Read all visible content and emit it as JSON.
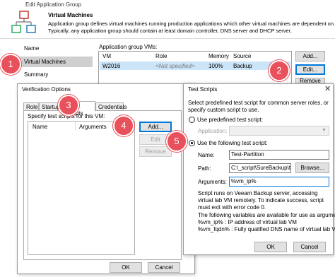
{
  "app_window": {
    "title": "Edit Application Group",
    "header_title": "Virtual Machines",
    "header_desc_1": "Application group defines virtual machines running production applications which other virtual machines are dependent on.",
    "header_desc_2": "Typically, any application group should contain at least domain controller, DNS server and DHCP server.",
    "nav": [
      "Name",
      "Virtual Machines",
      "Summary"
    ],
    "vms_label": "Application group VMs:",
    "columns": [
      "VM",
      "Role",
      "Memory",
      "Source"
    ],
    "rows": [
      {
        "vm": "W2016",
        "role": "<Not specified>",
        "memory": "100%",
        "source": "Backup"
      }
    ],
    "buttons": {
      "add": "Add...",
      "edit": "Edit...",
      "remove": "Remove"
    }
  },
  "verification": {
    "title": "Verification Options",
    "tabs": [
      "Role",
      "Startup",
      "Test Scripts",
      "Credentials"
    ],
    "specify_label": "Specify test scripts for this VM:",
    "columns": [
      "Name",
      "Arguments"
    ],
    "buttons": {
      "add": "Add...",
      "edit": "Edit",
      "remove": "Remove"
    },
    "ok": "OK",
    "cancel": "Cancel"
  },
  "test_scripts": {
    "title": "Test Scripts",
    "intro": "Select predefined test script for common server roles, or specify custom script to use.",
    "use_predefined": "Use predefined test script:",
    "application_label": "Application:",
    "use_following": "Use the following test script:",
    "name_label": "Name:",
    "name_value": "Test-Partition",
    "path_label": "Path:",
    "path_value": "C:\\_script\\SureBackup\\test-pa",
    "browse": "Browse...",
    "arguments_label": "Arguments:",
    "arguments_value": "%vm_ip%",
    "info_1": "Script runs on Veeam Backup server, accessing virtual lab VM remotely. To indicate success, script must exit with error code 0.",
    "info_2": "The following variables are available for use as arguments:",
    "info_3": "%vm_ip% : IP address of virtual lab VM",
    "info_4": "%vm_fqdn% : Fully qualified DNS name of virtual lab VM",
    "ok": "OK",
    "cancel": "Cancel"
  },
  "badges": [
    "1",
    "2",
    "3",
    "4",
    "5"
  ],
  "colors": {
    "badge": "#e8505b",
    "selection": "#cce4f7",
    "focus": "#0078d7"
  }
}
